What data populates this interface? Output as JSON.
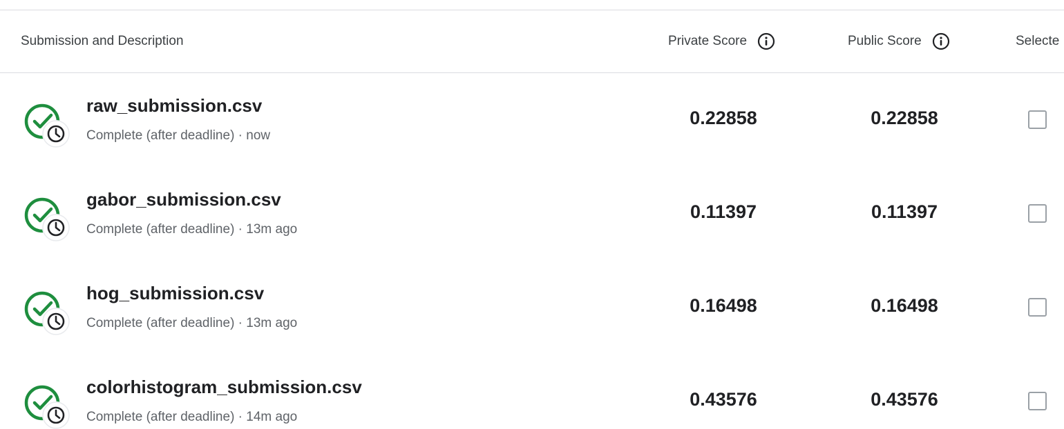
{
  "table": {
    "headers": {
      "description": "Submission and Description",
      "private_score": "Private Score",
      "public_score": "Public Score",
      "selected": "Selecte"
    },
    "rows": [
      {
        "file_name": "raw_submission.csv",
        "status": "Complete (after deadline)",
        "time": "now",
        "private_score": "0.22858",
        "public_score": "0.22858"
      },
      {
        "file_name": "gabor_submission.csv",
        "status": "Complete (after deadline)",
        "time": "13m ago",
        "private_score": "0.11397",
        "public_score": "0.11397"
      },
      {
        "file_name": "hog_submission.csv",
        "status": "Complete (after deadline)",
        "time": "13m ago",
        "private_score": "0.16498",
        "public_score": "0.16498"
      },
      {
        "file_name": "colorhistogram_submission.csv",
        "status": "Complete (after deadline)",
        "time": "14m ago",
        "private_score": "0.43576",
        "public_score": "0.43576"
      }
    ]
  },
  "icons": {
    "status": "complete-check-with-clock-icon",
    "info": "info-icon"
  },
  "colors": {
    "success_green": "#1e8e3e",
    "text_primary": "#202124",
    "text_secondary": "#5f6368",
    "divider": "#dadce0",
    "checkbox_border": "#9aa0a6"
  }
}
